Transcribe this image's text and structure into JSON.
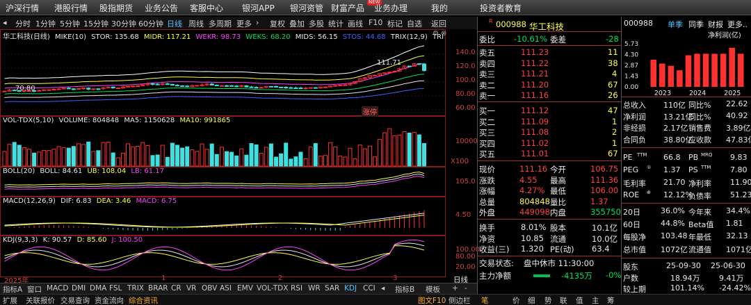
{
  "nav": {
    "items": [
      "沪深行情",
      "港股行情",
      "股指期货",
      "业务公告",
      "客服中心",
      "银河APP",
      "银河资管",
      "财富产品",
      "业务办理",
      "我的",
      "投资者教育"
    ],
    "new_badge": "NEW"
  },
  "toolbar": {
    "items": [
      "分时",
      "1分钟",
      "5分钟",
      "15分钟",
      "30分钟",
      "60分钟",
      "日线",
      "周线",
      "多周期",
      "更多",
      "复权",
      "叠加",
      "多股",
      "统计",
      "画线",
      "F10",
      "标记",
      "自选",
      "返回"
    ],
    "active": "日线"
  },
  "main_panel": {
    "title": "华工科技(日线)",
    "mike": "MIKE(10)",
    "stor": "STOR: 135.68",
    "midr": "MIDR: 117.21",
    "wekr": "WEKR: 98.73",
    "weks": "WEKS: 68.20",
    "mids": "MIDS: 56.15",
    "stos": "STOS: 44.68",
    "trix": "TRIX(12,9)",
    "trix_short": "TRI",
    "high_mark": "111.71",
    "low_mark": "70.80",
    "limit_up": "涨停",
    "y_ticks": [
      "140.0",
      "120.0",
      "100.0",
      "80.00",
      "60.00"
    ]
  },
  "vol_panel": {
    "name": "VOL-TDX(5,10)",
    "volume": "VOLUME: 804848",
    "ma5": "MA5: 1150628",
    "ma10": "MA10: 991865",
    "y_tick": "10000",
    "unit": "X100"
  },
  "boll_panel": {
    "name": "BOLL(20)",
    "boll": "BOLL: 84.61",
    "ub": "UB: 108.04",
    "lb": "LB: 61.17",
    "y_tick": "105.0"
  },
  "macd_panel": {
    "name": "MACD(12,26,9)",
    "dif": "DIF: 6.83",
    "dea": "DEA: 3.46",
    "macd": "MACD: 6.75",
    "y_tick": "4.50"
  },
  "kdj_panel": {
    "name": "KDJ(9,3,3)",
    "k": "K: 90.57",
    "d": "D: 85.60",
    "j": "J: 100.50",
    "y_ticks": [
      "100.00",
      "80.00",
      "20.00"
    ],
    "x_labels": [
      "2025年",
      "1",
      "2",
      "3"
    ],
    "day_line": "日线"
  },
  "bottom_tabs": {
    "items": [
      "指标A",
      "窗口",
      "MACD",
      "DMI",
      "DMA",
      "FSL",
      "TRIX",
      "BRAR",
      "CR",
      "VR",
      "OBV",
      "ASI",
      "EMV",
      "VOL-TDX",
      "RSI",
      "WR",
      "SAR",
      "KDJ",
      "CCI"
    ],
    "active": "KDJ",
    "right": [
      "指标B",
      "模板"
    ]
  },
  "status_bar": {
    "items": [
      "扩展",
      "关联报价",
      "交易查询",
      "资金流向",
      "综合资讯"
    ],
    "right": [
      "图文F10",
      "侧边栏",
      "笔",
      "价",
      "细",
      "势",
      "联",
      "值",
      "主",
      "筹"
    ]
  },
  "quote": {
    "r_mark": "R",
    "code": "000988",
    "name": "华工科技",
    "weibi_label": "委比",
    "weibi": "-10.61%",
    "weicha_label": "委差",
    "weicha": "-28",
    "asks": [
      {
        "label": "卖五",
        "price": "111.23",
        "vol": "11"
      },
      {
        "label": "卖四",
        "price": "111.22",
        "vol": "38"
      },
      {
        "label": "卖三",
        "price": "111.21",
        "vol": "4"
      },
      {
        "label": "卖二",
        "price": "111.20",
        "vol": "67"
      },
      {
        "label": "卖一",
        "price": "111.16",
        "vol": "26"
      }
    ],
    "bids": [
      {
        "label": "买一",
        "price": "111.12",
        "vol": "47"
      },
      {
        "label": "买二",
        "price": "111.09",
        "vol": "1"
      },
      {
        "label": "买三",
        "price": "111.08",
        "vol": "2"
      },
      {
        "label": "买四",
        "price": "111.02",
        "vol": "1"
      },
      {
        "label": "买五",
        "price": "111.01",
        "vol": "67"
      }
    ],
    "stats": [
      {
        "l1": "现价",
        "v1": "111.16",
        "l2": "今开",
        "v2": "106.75"
      },
      {
        "l1": "涨跌",
        "v1": "4.55",
        "l2": "最高",
        "v2": "111.36"
      },
      {
        "l1": "涨幅",
        "v1": "4.27%",
        "l2": "最低",
        "v2": "106.00"
      },
      {
        "l1": "总量",
        "v1": "804848",
        "l2": "量比",
        "v2": "1.37"
      },
      {
        "l1": "外盘",
        "v1": "449098",
        "l2": "内盘",
        "v2": "355750"
      }
    ],
    "stats2": [
      {
        "l1": "换手",
        "v1": "8.01%",
        "l2": "股本",
        "v2": "10.1亿"
      },
      {
        "l1": "净资",
        "v1": "10.85",
        "l2": "流通",
        "v2": "10.0亿"
      },
      {
        "l1": "收益(三)",
        "v1": "1.320",
        "l2": "PE(动)",
        "v2": "63.4"
      }
    ],
    "trade_status_label": "交易状态:",
    "trade_status": "盘中休市 11:30:00",
    "main_flow_label": "主力净额",
    "main_flow": "-4135万",
    "main_flow_pct": "-0%"
  },
  "right": {
    "code": "000988",
    "tabs": [
      "单季",
      "同季",
      "财报",
      "更多.."
    ],
    "active_tab": "单季",
    "chart_label": "净利润(亿)",
    "y_ticks": [
      "5.73",
      "4.30",
      "2.87",
      "1.43",
      "0.00"
    ],
    "years": [
      "2023",
      "2024",
      "2025"
    ],
    "fin": [
      {
        "l1": "总收入",
        "v1": "110亿",
        "l2": "同比%",
        "v2": "22.62"
      },
      {
        "l1": "净利润",
        "v1": "13.21亿",
        "l2": "同比%",
        "v2": "40.92"
      },
      {
        "l1": "非经损",
        "v1": "2.17亿",
        "l2": "销售费",
        "v2": "3.89亿"
      },
      {
        "l1": "合同负",
        "v1": "38.80亿",
        "l2": "应收款",
        "v2": "47.83亿"
      }
    ],
    "val": [
      {
        "l1": "PE",
        "s1": "TTM",
        "v1": "66.8",
        "l2": "PB",
        "s2": "MRQ",
        "v2": "9.83"
      },
      {
        "l1": "PEG",
        "s1": "①",
        "v1": "1.37",
        "l2": "PS",
        "s2": "TTM",
        "v2": "7.80"
      },
      {
        "l1": "毛利率",
        "s1": "",
        "v1": "21.70",
        "l2": "净利率",
        "s2": "",
        "v2": "11.90"
      },
      {
        "l1": "ROE",
        "s1": "⊕",
        "v1": "12.12%",
        "l2": "负债率",
        "s2": "",
        "v2": "51.23"
      }
    ],
    "perf": [
      {
        "l1": "20日",
        "v1": "36.0%",
        "l2": "今年来",
        "v2": "34.4%"
      },
      {
        "l1": "60日",
        "v1": "44.8%",
        "l2": "Beta值",
        "v2": "1.81"
      },
      {
        "l1": "每股净",
        "v1": "103.48",
        "l2": "年最低",
        "v2": "32.13"
      },
      {
        "l1": "总市值",
        "v1": "1072亿",
        "l2": "流通值",
        "v2": "1071亿"
      }
    ],
    "holders": {
      "label": "股东",
      "d1": "25-09-30",
      "d2": "25-06-30",
      "rows": [
        {
          "l": "户数",
          "v1": "18.94万",
          "v2": "9.41万"
        },
        {
          "l": "较上期",
          "v1": "101.14%",
          "v2": "-24.42%"
        }
      ]
    }
  },
  "chart_data": {
    "type": "bar",
    "title": "净利润(亿)",
    "categories": [
      "2023Q1",
      "2023Q2",
      "2023Q3",
      "2023Q4",
      "2024Q1",
      "2024Q2",
      "2024Q3",
      "2024Q4",
      "2025Q1",
      "2025Q2",
      "2025Q3"
    ],
    "values": [
      3.6,
      3.1,
      2.8,
      2.2,
      4.2,
      4.4,
      4.4,
      4.4,
      4.4,
      5.2,
      4.4
    ],
    "ylim": [
      0,
      5.73
    ],
    "colors": {
      "bar": "#ff3030"
    }
  }
}
